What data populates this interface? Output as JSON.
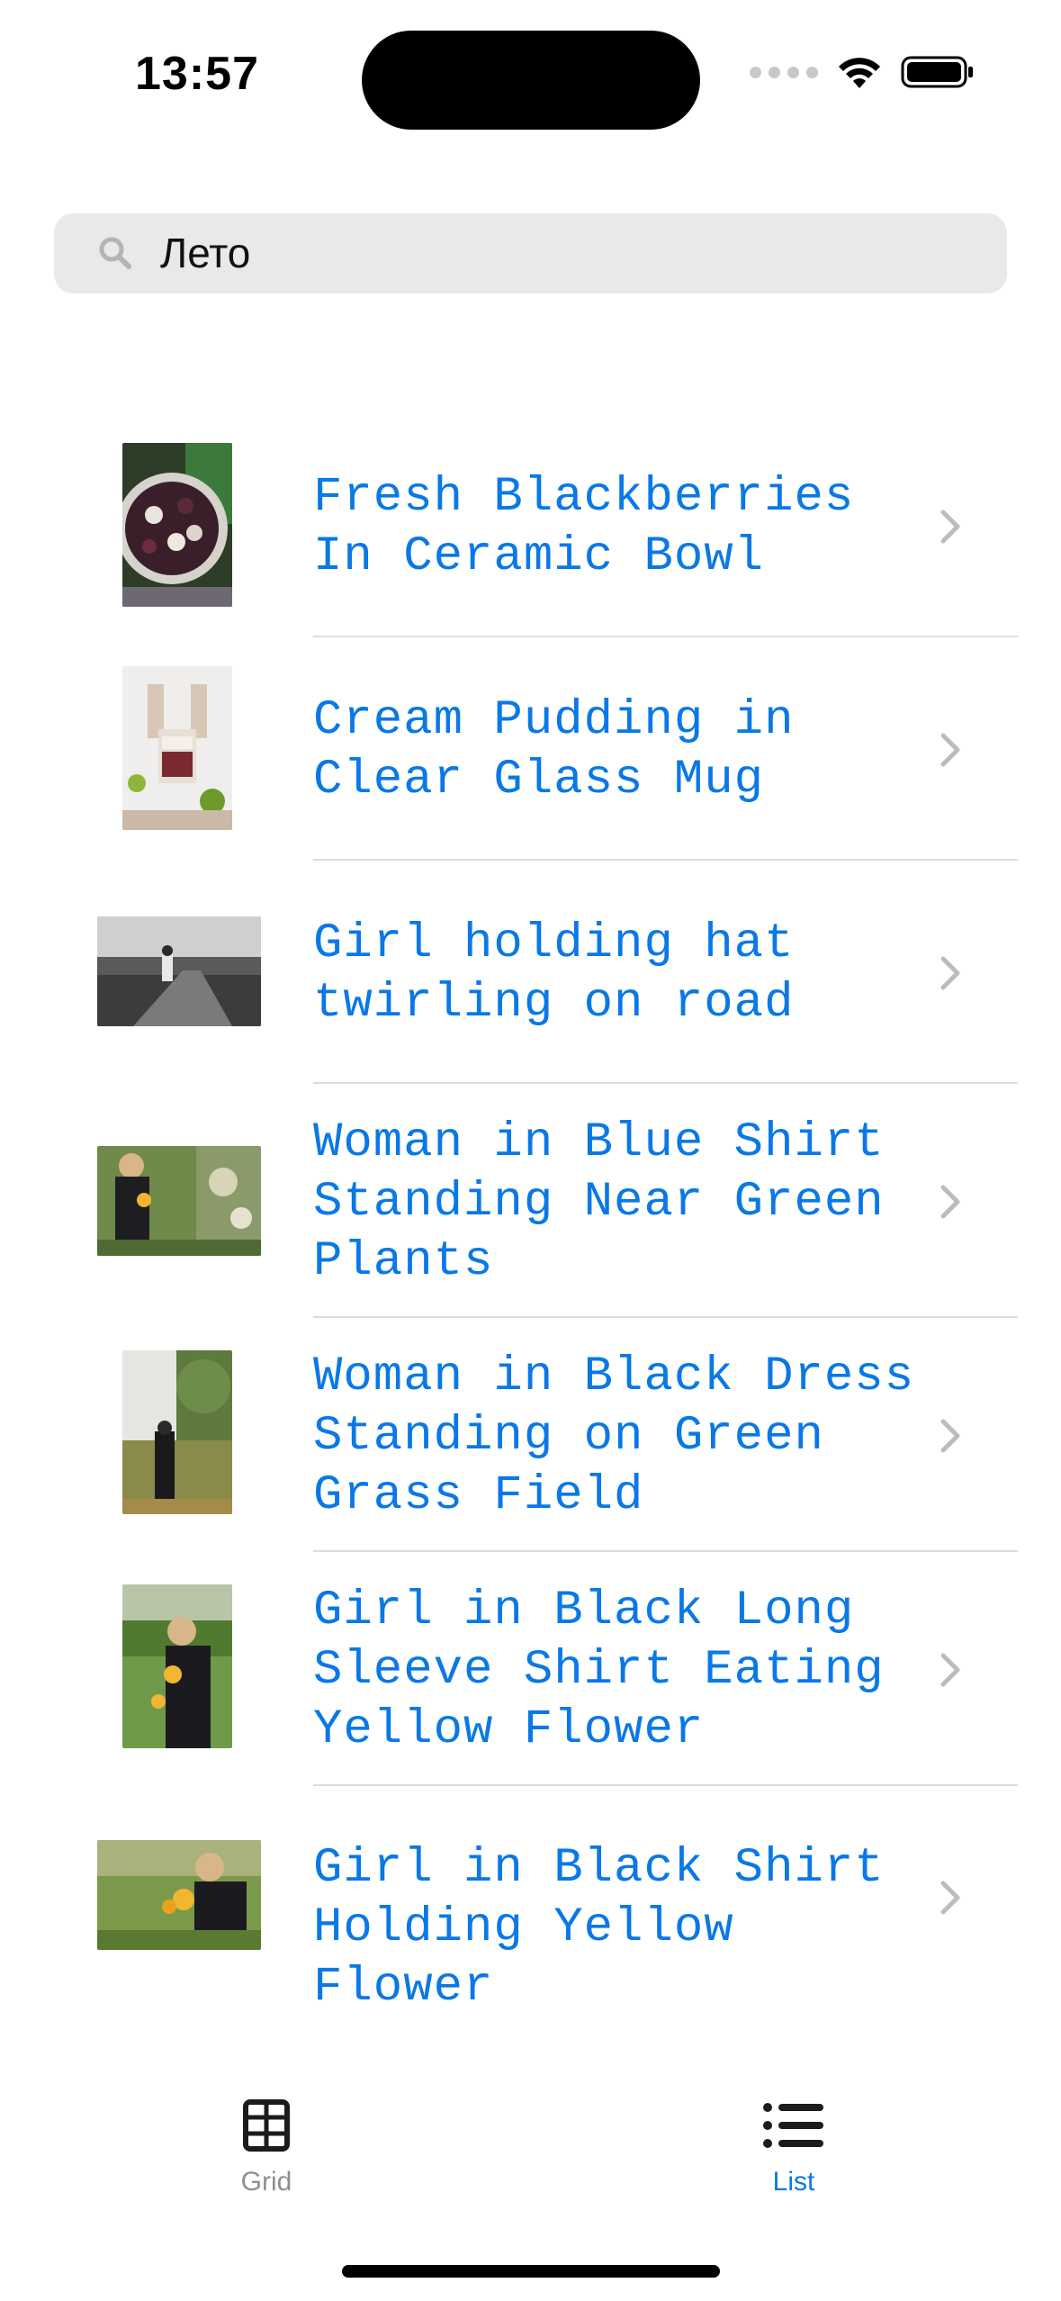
{
  "status": {
    "time": "13:57"
  },
  "search": {
    "value": "Лето"
  },
  "items": [
    {
      "title": "Fresh Blackberries In Ceramic Bowl"
    },
    {
      "title": "Cream Pudding in Clear Glass Mug"
    },
    {
      "title": "Girl holding hat twirling on road"
    },
    {
      "title": "Woman in Blue Shirt Standing Near Green Plants"
    },
    {
      "title": "Woman in Black Dress Standing on Green Grass Field"
    },
    {
      "title": "Girl in Black Long Sleeve Shirt Eating Yellow Flower"
    },
    {
      "title": "Girl in Black Shirt Holding Yellow Flower"
    }
  ],
  "tabs": [
    {
      "label": "Grid",
      "icon": "grid-icon",
      "selected": false
    },
    {
      "label": "List",
      "icon": "list-icon",
      "selected": true
    }
  ],
  "colors": {
    "accent": "#0a78e6",
    "inactive_tab": "#8e8e93",
    "search_bg": "#e9e9ea"
  }
}
